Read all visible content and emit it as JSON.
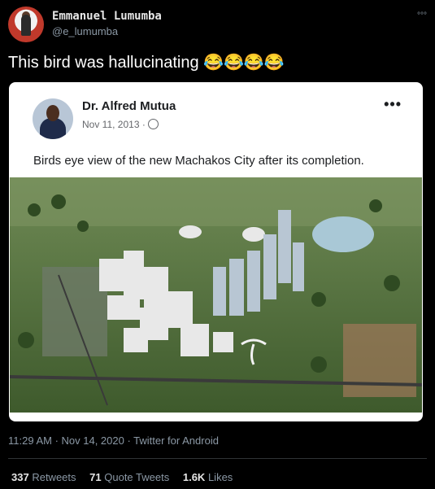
{
  "user": {
    "display_name": "Emmanuel Lumumba",
    "handle": "@e_lumumba"
  },
  "tweet": {
    "text": "This bird was hallucinating 😂😂😂😂",
    "more_label": "°°°"
  },
  "embedded_post": {
    "author": "Dr. Alfred Mutua",
    "date": "Nov 11, 2013 ·",
    "more_label": "•••",
    "text": "Birds eye view of the new Machakos City after its completion."
  },
  "meta": {
    "timestamp": "11:29 AM · Nov 14, 2020 · Twitter for Android"
  },
  "stats": {
    "retweets_count": "337",
    "retweets_label": "Retweets",
    "quote_count": "71",
    "quote_label": "Quote Tweets",
    "likes_count": "1.6K",
    "likes_label": "Likes"
  },
  "colors": {
    "background": "#000000",
    "text_secondary": "#8b98a5",
    "embed_background": "#ffffff"
  }
}
